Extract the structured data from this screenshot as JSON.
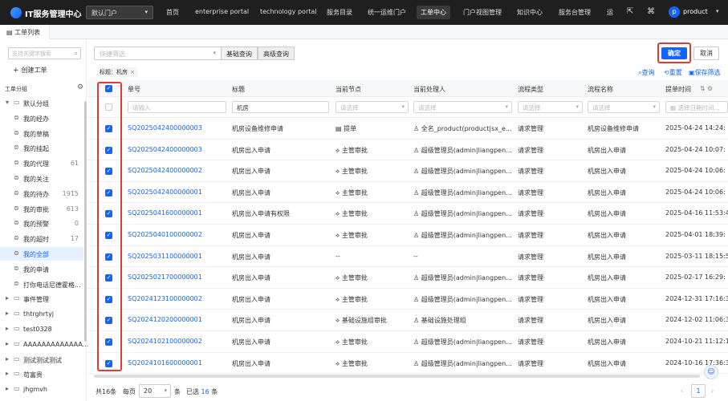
{
  "topbar": {
    "app_title": "IT服务管理中心",
    "portal_select": "默认门户",
    "nav": [
      "首页",
      "enterprise portal",
      "technology portal",
      "服务目录",
      "统一运维门户",
      "工单中心",
      "门户视图管理",
      "知识中心",
      "服务台管理",
      "运"
    ],
    "active_nav": "工单中心",
    "avatar_letter": "p",
    "user": "product"
  },
  "tabbar": {
    "tab": "工单列表"
  },
  "sidebar": {
    "search_placeholder": "支持关键字搜索",
    "create": "创建工单",
    "group_title": "工单分组",
    "items": [
      {
        "label": "默认分组",
        "count": "",
        "type": "folder"
      },
      {
        "label": "我的经办",
        "count": "",
        "type": "leaf"
      },
      {
        "label": "我的草稿",
        "count": "",
        "type": "leaf"
      },
      {
        "label": "我的挂起",
        "count": "",
        "type": "leaf"
      },
      {
        "label": "我的代理",
        "count": "61",
        "type": "leaf"
      },
      {
        "label": "我的关注",
        "count": "",
        "type": "leaf"
      },
      {
        "label": "我的待办",
        "count": "1915",
        "type": "leaf"
      },
      {
        "label": "我的审批",
        "count": "613",
        "type": "leaf"
      },
      {
        "label": "我的预警",
        "count": "0",
        "type": "leaf"
      },
      {
        "label": "我的超时",
        "count": "17",
        "type": "leaf"
      },
      {
        "label": "我的全部",
        "count": "",
        "type": "leaf",
        "active": true
      },
      {
        "label": "我的申请",
        "count": "",
        "type": "leaf"
      },
      {
        "label": "打你电话尼德霍格...",
        "count": "",
        "type": "leaf"
      },
      {
        "label": "事件管理",
        "count": "",
        "type": "folder"
      },
      {
        "label": "thtrghrtyj",
        "count": "",
        "type": "folder"
      },
      {
        "label": "test0328",
        "count": "",
        "type": "folder"
      },
      {
        "label": "AAAAAAAAAAAAA...",
        "count": "",
        "type": "folder"
      },
      {
        "label": "测试测试测试",
        "count": "",
        "type": "folder"
      },
      {
        "label": "苟富贵",
        "count": "",
        "type": "folder"
      },
      {
        "label": "jhgmvh",
        "count": "",
        "type": "folder"
      }
    ]
  },
  "toolbar": {
    "quick_placeholder": "快捷筛选",
    "basic_query": "基础查询",
    "advanced_query": "高级查询",
    "confirm": "确定",
    "cancel": "取消",
    "filter_tag": "标题：机房",
    "query": "查询",
    "reset": "重置",
    "save_filter": "保存筛选"
  },
  "table": {
    "headers": {
      "no": "单号",
      "title": "标题",
      "node": "当前节点",
      "handler": "当前处理人",
      "ptype": "流程类型",
      "pname": "流程名称",
      "time": "提单时间"
    },
    "filters": {
      "no": "请输入",
      "title": "机房",
      "node": "请选择",
      "handler": "请选择",
      "ptype": "请选择",
      "pname": "请选择",
      "time": "选择日期时间..."
    },
    "rows": [
      {
        "no": "SQ2025042400000003",
        "title": "机房设备维修申请",
        "node": "提单",
        "handler": "全名_product(product|sx_e...",
        "ptype": "请求管理",
        "pname": "机房设备维修申请",
        "time": "2025-04-24 14:24:"
      },
      {
        "no": "SQ2025042400000003",
        "title": "机房出入申请",
        "node": "主管审批",
        "handler": "超级管理员(admin|liangpen...",
        "ptype": "请求管理",
        "pname": "机房出入申请",
        "time": "2025-04-24 10:07:"
      },
      {
        "no": "SQ2025042400000002",
        "title": "机房出入申请",
        "node": "主管审批",
        "handler": "超级管理员(admin|liangpen...",
        "ptype": "请求管理",
        "pname": "机房出入申请",
        "time": "2025-04-24 10:06:"
      },
      {
        "no": "SQ2025042400000001",
        "title": "机房出入申请",
        "node": "主管审批",
        "handler": "超级管理员(admin|liangpen...",
        "ptype": "请求管理",
        "pname": "机房出入申请",
        "time": "2025-04-24 10:06:"
      },
      {
        "no": "SQ2025041600000001",
        "title": "机房出入申请有权限",
        "node": "主管审批",
        "handler": "超级管理员(admin|liangpen...",
        "ptype": "请求管理",
        "pname": "机房出入申请",
        "time": "2025-04-16 11:53:4"
      },
      {
        "no": "SQ2025040100000002",
        "title": "机房出入申请",
        "node": "主管审批",
        "handler": "超级管理员(admin|liangpen...",
        "ptype": "请求管理",
        "pname": "机房出入申请",
        "time": "2025-04-01 18:39:"
      },
      {
        "no": "SQ2025031100000001",
        "title": "机房出入申请",
        "node": "--",
        "handler": "--",
        "ptype": "请求管理",
        "pname": "机房出入申请",
        "time": "2025-03-11 18:15:5"
      },
      {
        "no": "SQ2025021700000001",
        "title": "机房出入申请",
        "node": "主管审批",
        "handler": "超级管理员(admin|liangpen...",
        "ptype": "请求管理",
        "pname": "机房出入申请",
        "time": "2025-02-17 16:29:"
      },
      {
        "no": "SQ2024123100000002",
        "title": "机房出入申请",
        "node": "主管审批",
        "handler": "超级管理员(admin|liangpen...",
        "ptype": "请求管理",
        "pname": "机房出入申请",
        "time": "2024-12-31 17:16:3"
      },
      {
        "no": "SQ2024120200000001",
        "title": "机房出入申请",
        "node": "基础设施组审批",
        "handler": "基础设施处理组",
        "ptype": "请求管理",
        "pname": "机房出入申请",
        "time": "2024-12-02 11:06:3"
      },
      {
        "no": "SQ2024102100000002",
        "title": "机房出入申请",
        "node": "主管审批",
        "handler": "超级管理员(admin|liangpen...",
        "ptype": "请求管理",
        "pname": "机房出入申请",
        "time": "2024-10-21 11:12:1"
      },
      {
        "no": "SQ2024101600000001",
        "title": "机房出入申请",
        "node": "主管审批",
        "handler": "超级管理员(admin|liangpen...",
        "ptype": "请求管理",
        "pname": "机房出入申请",
        "time": "2024-10-16 17:36:3"
      }
    ]
  },
  "footer": {
    "total": "共16条",
    "per_page_label": "每页",
    "per_page": "20",
    "unit": "条",
    "selected_prefix": "已选",
    "selected_count": "16",
    "selected_unit": "条",
    "prev": "‹",
    "page": "1",
    "next": "›"
  }
}
